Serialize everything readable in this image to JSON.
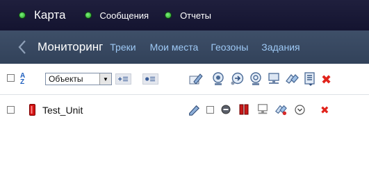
{
  "top_tabs": [
    {
      "label": "Карта"
    },
    {
      "label": "Сообщения"
    },
    {
      "label": "Отчеты"
    }
  ],
  "nav": {
    "title": "Мониторинг",
    "links": [
      "Треки",
      "Мои места",
      "Геозоны",
      "Задания"
    ]
  },
  "toolbar": {
    "sort_icon": "sort-az-icon",
    "sort_letters": [
      "A",
      "Z"
    ],
    "select_value": "Объекты",
    "icons": [
      "pencil-icon",
      "locate-icon",
      "command-icon",
      "tracking-icon",
      "computer-icon",
      "link-icon",
      "list-icon",
      "delete-icon"
    ]
  },
  "unit": {
    "name": "Test_Unit",
    "icons": [
      "pencil-icon",
      "checkbox-icon",
      "minus-circle-icon",
      "signal-icon",
      "computer-icon",
      "link-icon",
      "chevron-down-icon",
      "delete-icon"
    ]
  },
  "colors": {
    "topbar": "#1a1a38",
    "subnav": "#394a63",
    "link": "#9ec9f5",
    "delete": "#e1231b"
  }
}
